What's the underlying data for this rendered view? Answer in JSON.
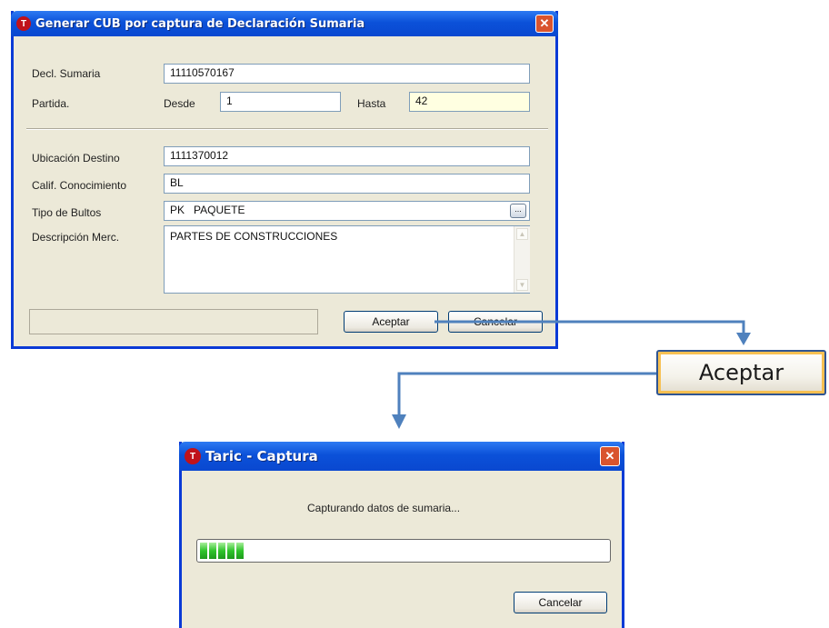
{
  "dialog1": {
    "title": "Generar CUB por captura de Declaración Sumaria",
    "decl_label": "Decl. Sumaria",
    "decl_value": "11110570167",
    "partida_label": "Partida.",
    "desde_label": "Desde",
    "desde_value": "1",
    "hasta_label": "Hasta",
    "hasta_value": "42",
    "ubicacion_label": "Ubicación Destino",
    "ubicacion_value": "1111370012",
    "calif_label": "Calif. Conocimiento",
    "calif_value": "BL",
    "tipo_label": "Tipo de Bultos",
    "tipo_value": "PK   PAQUETE",
    "desc_label": "Descripción Merc.",
    "desc_value": "PARTES DE CONSTRUCCIONES",
    "aceptar_label": "Aceptar",
    "cancelar_label": "Cancelar"
  },
  "callout": {
    "label": "Aceptar"
  },
  "dialog2": {
    "title": "Taric - Captura",
    "message": "Capturando datos de sumaria...",
    "progress_fraction": 0.12,
    "cancelar_label": "Cancelar"
  },
  "colors": {
    "title_bar": "#0b51d9",
    "arrow": "#4f81bd",
    "progress_green": "#2fc42b",
    "close_red": "#d9542e",
    "hasta_field_bg": "#ffffe1"
  }
}
